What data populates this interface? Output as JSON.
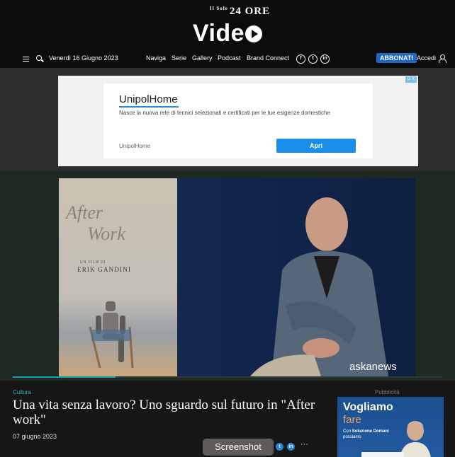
{
  "header": {
    "brand_prefix": "Il Sole",
    "brand_name": "24 ORE",
    "section_title": "Vide"
  },
  "nav": {
    "date": "Venerdì 16 Giugno 2023",
    "links": [
      "Naviga",
      "Serie",
      "Gallery",
      "Podcast",
      "Brand Connect"
    ],
    "social": [
      "f",
      "t",
      "in"
    ],
    "subscribe_label": "ABBONATI",
    "login_label": "Accedi"
  },
  "ad_banner": {
    "title": "UnipolHome",
    "description": "Nasce la nuova rete di tecnici selezionati e certificati per le tue esigenze domestiche",
    "advertiser": "UnipolHome",
    "cta_label": "Apri",
    "choices_label": "D X"
  },
  "video": {
    "poster_title_line1": "After",
    "poster_title_line2": "Work",
    "poster_director_prefix": "UN FILM DI",
    "poster_director": "ERIK GANDINI",
    "watermark": "askanews",
    "progress": 0.24
  },
  "article": {
    "category": "Cultura",
    "headline": "Una vita senza lavoro? Uno sguardo sul futuro in \"After work\"",
    "date": "07 giugno 2023",
    "share_icons": [
      "t",
      "in"
    ],
    "more_label": "···"
  },
  "overlay": {
    "screenshot_label": "Screenshot"
  },
  "side_ad": {
    "label": "Pubblicità",
    "title": "Vogliamo",
    "subtitle": "fare",
    "line_prefix": "Con ",
    "line_bold": "Soluzione Domani",
    "line2": "possiamo"
  },
  "colors": {
    "accent": "#1f67c4",
    "category": "#2bb6c6",
    "cta": "#1a8ee8"
  }
}
